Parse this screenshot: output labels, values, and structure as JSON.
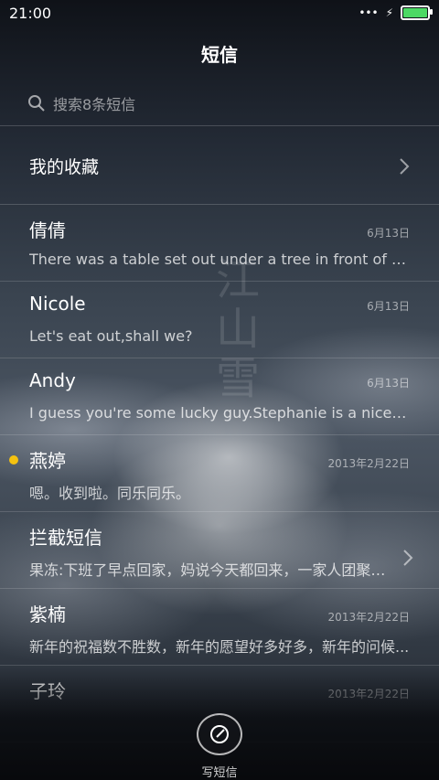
{
  "status": {
    "time": "21:00",
    "battery_fill_pct": 100
  },
  "header": {
    "title": "短信"
  },
  "search": {
    "placeholder": "搜索8条短信"
  },
  "favorites": {
    "label": "我的收藏"
  },
  "conversations": [
    {
      "name": "倩倩",
      "date": "6月13日",
      "preview": "There was a table set out under a tree in front of the ho...",
      "unread": false,
      "chevron": false
    },
    {
      "name": "Nicole",
      "date": "6月13日",
      "preview": "Let's eat out,shall we?",
      "unread": false,
      "chevron": false
    },
    {
      "name": "Andy",
      "date": "6月13日",
      "preview": "I guess you're some lucky guy.Stephanie is a nice girl.",
      "unread": false,
      "chevron": false
    },
    {
      "name": "燕婷",
      "date": "2013年2月22日",
      "preview": "嗯。收到啦。同乐同乐。",
      "unread": true,
      "chevron": false
    },
    {
      "name": "拦截短信",
      "date": "",
      "preview": "果冻:下班了早点回家，妈说今天都回来，一家人团聚过...",
      "unread": false,
      "chevron": true
    },
    {
      "name": "紫楠",
      "date": "2013年2月22日",
      "preview": "新年的祝福数不胜数，新年的愿望好多好多，新年的问候...",
      "unread": false,
      "chevron": false
    },
    {
      "name": "子玲",
      "date": "2013年2月22日",
      "preview": "",
      "unread": false,
      "chevron": false
    }
  ],
  "compose": {
    "label": "写短信"
  },
  "colors": {
    "unread_dot": "#f5c211",
    "battery": "#4cd964"
  }
}
